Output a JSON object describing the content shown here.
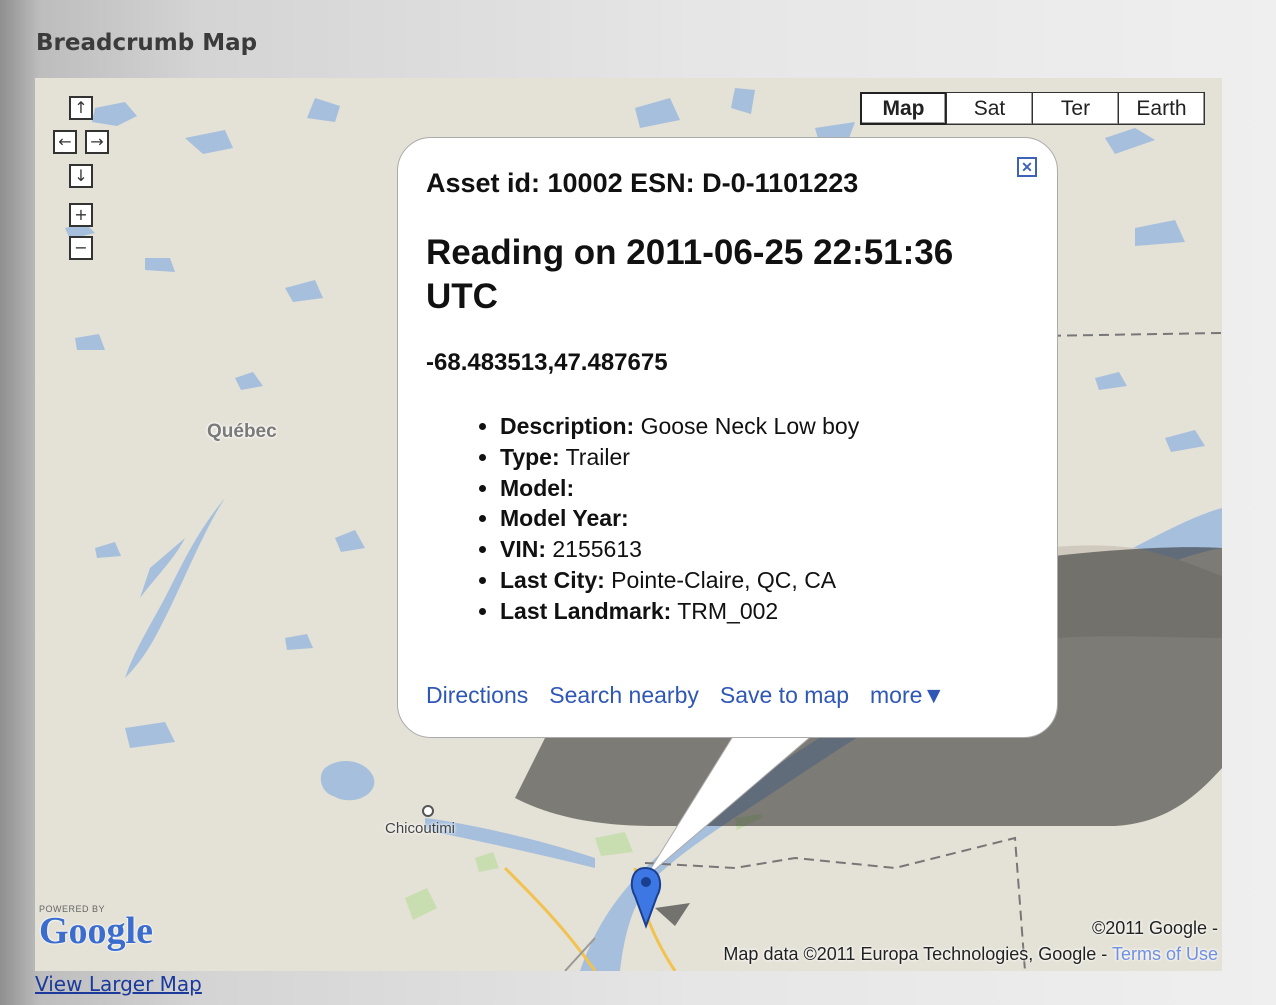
{
  "page": {
    "heading": "Breadcrumb Map",
    "view_larger_link": "View Larger Map"
  },
  "map": {
    "places": {
      "quebec": "Québec",
      "chicoutimi": "Chicoutimi"
    },
    "nav_icons": [
      "pan-up-icon",
      "pan-left-icon",
      "pan-right-icon",
      "pan-down-icon",
      "zoom-in-icon",
      "zoom-out-icon"
    ],
    "map_types": [
      {
        "label": "Map",
        "active": true
      },
      {
        "label": "Sat",
        "active": false
      },
      {
        "label": "Ter",
        "active": false
      },
      {
        "label": "Earth",
        "active": false
      }
    ],
    "logo": {
      "powered_by": "POWERED BY",
      "brand": "Google"
    },
    "copyright": "©2011 Google -",
    "attribution": "Map data ©2011 Europa Technologies, Google -",
    "terms_link": "Terms of Use",
    "colors": {
      "land": "#e4e1d6",
      "water": "#a6bfdd",
      "forest": "#c9deb0",
      "marker": "#3d77e3"
    }
  },
  "info_window": {
    "asset_heading": "Asset id: 10002 ESN: D-0-1101223",
    "reading_heading": "Reading on 2011-06-25 22:51:36 UTC",
    "coordinates": "-68.483513,47.487675",
    "details": [
      {
        "label": "Description:",
        "value": " Goose Neck Low boy"
      },
      {
        "label": "Type:",
        "value": " Trailer"
      },
      {
        "label": "Model:",
        "value": ""
      },
      {
        "label": "Model Year:",
        "value": ""
      },
      {
        "label": "VIN:",
        "value": " 2155613"
      },
      {
        "label": "Last City:",
        "value": " Pointe-Claire, QC, CA"
      },
      {
        "label": "Last Landmark:",
        "value": " TRM_002"
      }
    ],
    "links": [
      "Directions",
      "Search nearby",
      "Save to map",
      "more▼"
    ]
  }
}
